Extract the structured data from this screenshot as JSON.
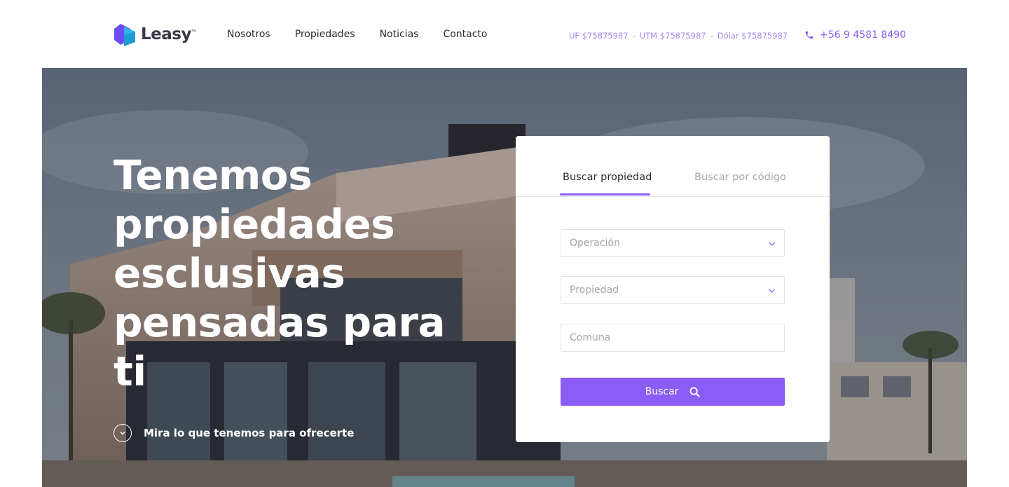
{
  "brand": {
    "name": "Leasy",
    "tm": "™"
  },
  "nav": {
    "items": [
      "Nosotros",
      "Propiedades",
      "Noticias",
      "Contacto"
    ]
  },
  "indicators": {
    "uf": "UF $75875987",
    "utm": "UTM $75875987",
    "dolar": "Dólar $75875987",
    "separator": "-"
  },
  "contact": {
    "phone": "+56 9 4581 8490"
  },
  "hero": {
    "title_lines": [
      "Tenemos",
      "propiedades",
      "esclusivas",
      "pensadas para ti"
    ],
    "discover_label": "Mira lo que tenemos para ofrecerte"
  },
  "search": {
    "tabs": [
      "Buscar propiedad",
      "Buscar por código"
    ],
    "active_tab": "Buscar propiedad",
    "fields": {
      "operacion": "Operación",
      "propiedad": "Propiedad",
      "comuna": "Comuna"
    },
    "button_label": "Buscar"
  },
  "colors": {
    "accent": "#8b5cf6",
    "indicator": "#a58bf2",
    "text": "#2b2b2b"
  }
}
